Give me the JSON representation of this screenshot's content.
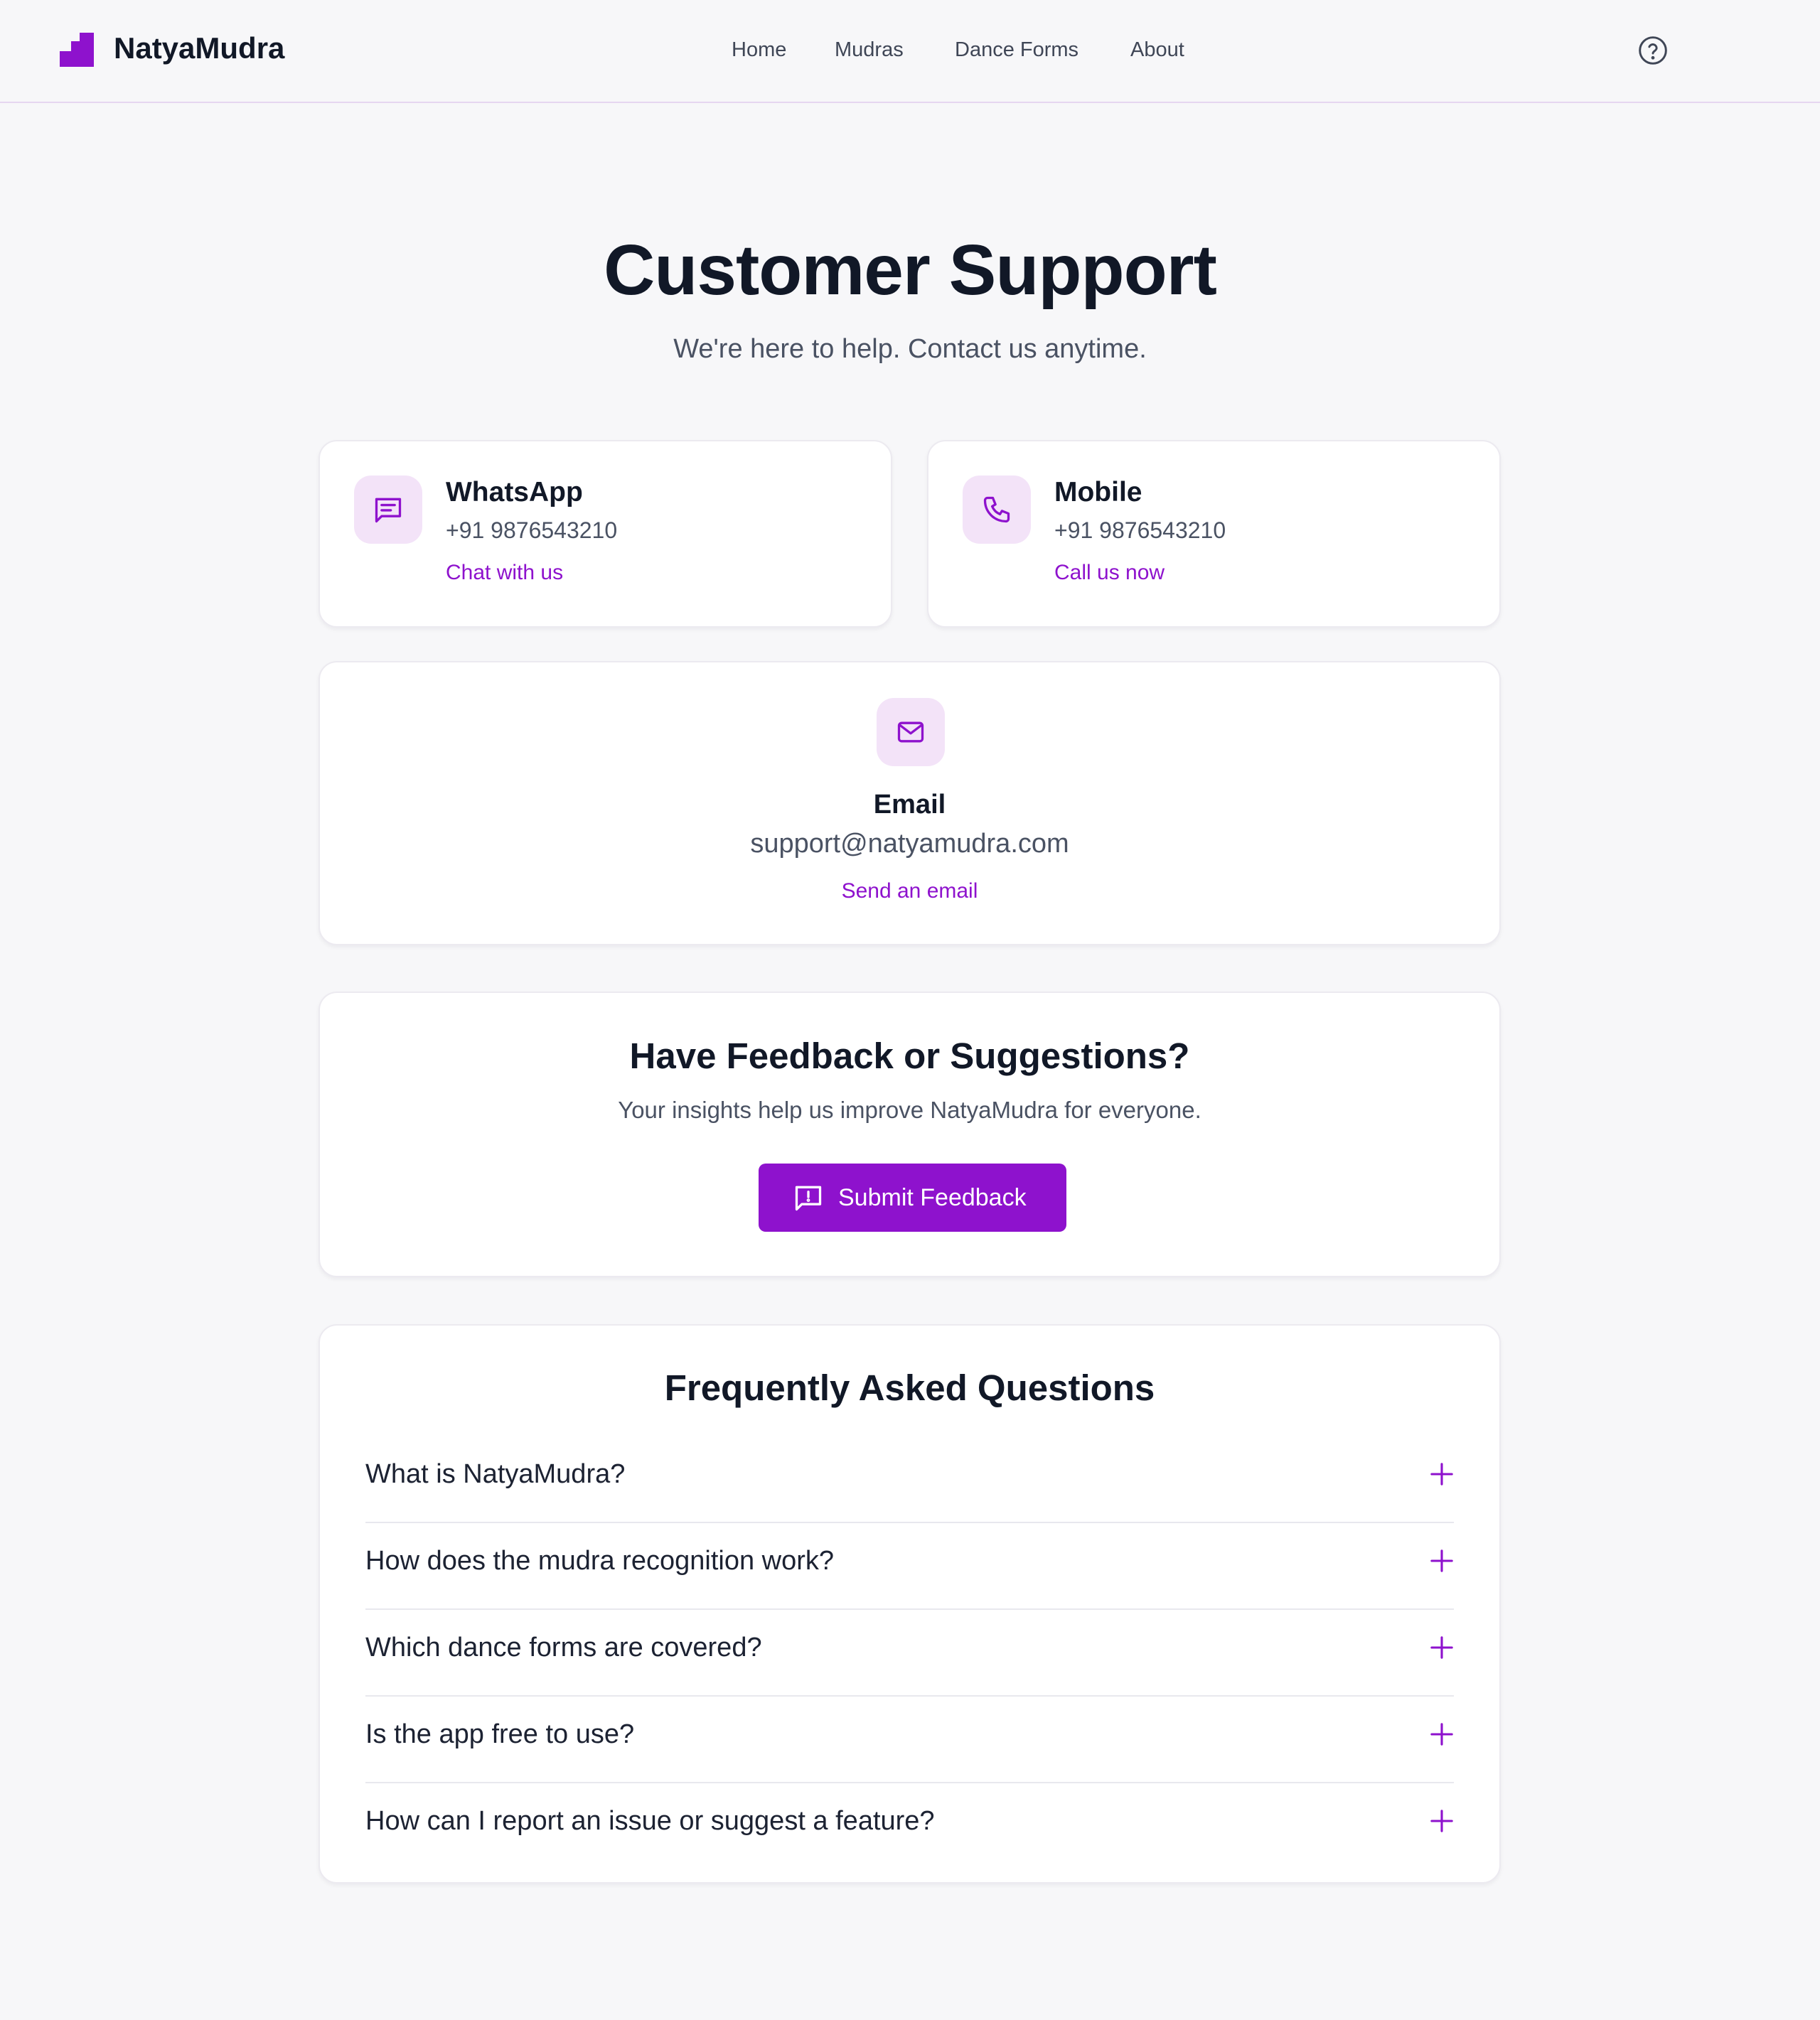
{
  "header": {
    "brand": "NatyaMudra",
    "nav": [
      "Home",
      "Mudras",
      "Dance Forms",
      "About"
    ],
    "accent_color": "#8e12cd",
    "help_icon": "help-circle-icon"
  },
  "hero": {
    "title": "Customer Support",
    "subtitle": "We're here to help. Contact us anytime."
  },
  "contacts": {
    "whatsapp": {
      "icon": "chat-icon",
      "title": "WhatsApp",
      "number": "+91 9876543210",
      "link": "Chat with us"
    },
    "mobile": {
      "icon": "phone-icon",
      "title": "Mobile",
      "number": "+91 9876543210",
      "link": "Call us now"
    },
    "email": {
      "icon": "mail-icon",
      "title": "Email",
      "address": "support@natyamudra.com",
      "link": "Send an email"
    }
  },
  "feedback": {
    "title": "Have Feedback or Suggestions?",
    "subtitle": "Your insights help us improve NatyaMudra for everyone.",
    "button": "Submit Feedback",
    "button_icon": "feedback-icon"
  },
  "faq": {
    "title": "Frequently Asked Questions",
    "items": [
      "What is NatyaMudra?",
      "How does the mudra recognition work?",
      "Which dance forms are covered?",
      "Is the app free to use?",
      "How can I report an issue or suggest a feature?"
    ]
  }
}
